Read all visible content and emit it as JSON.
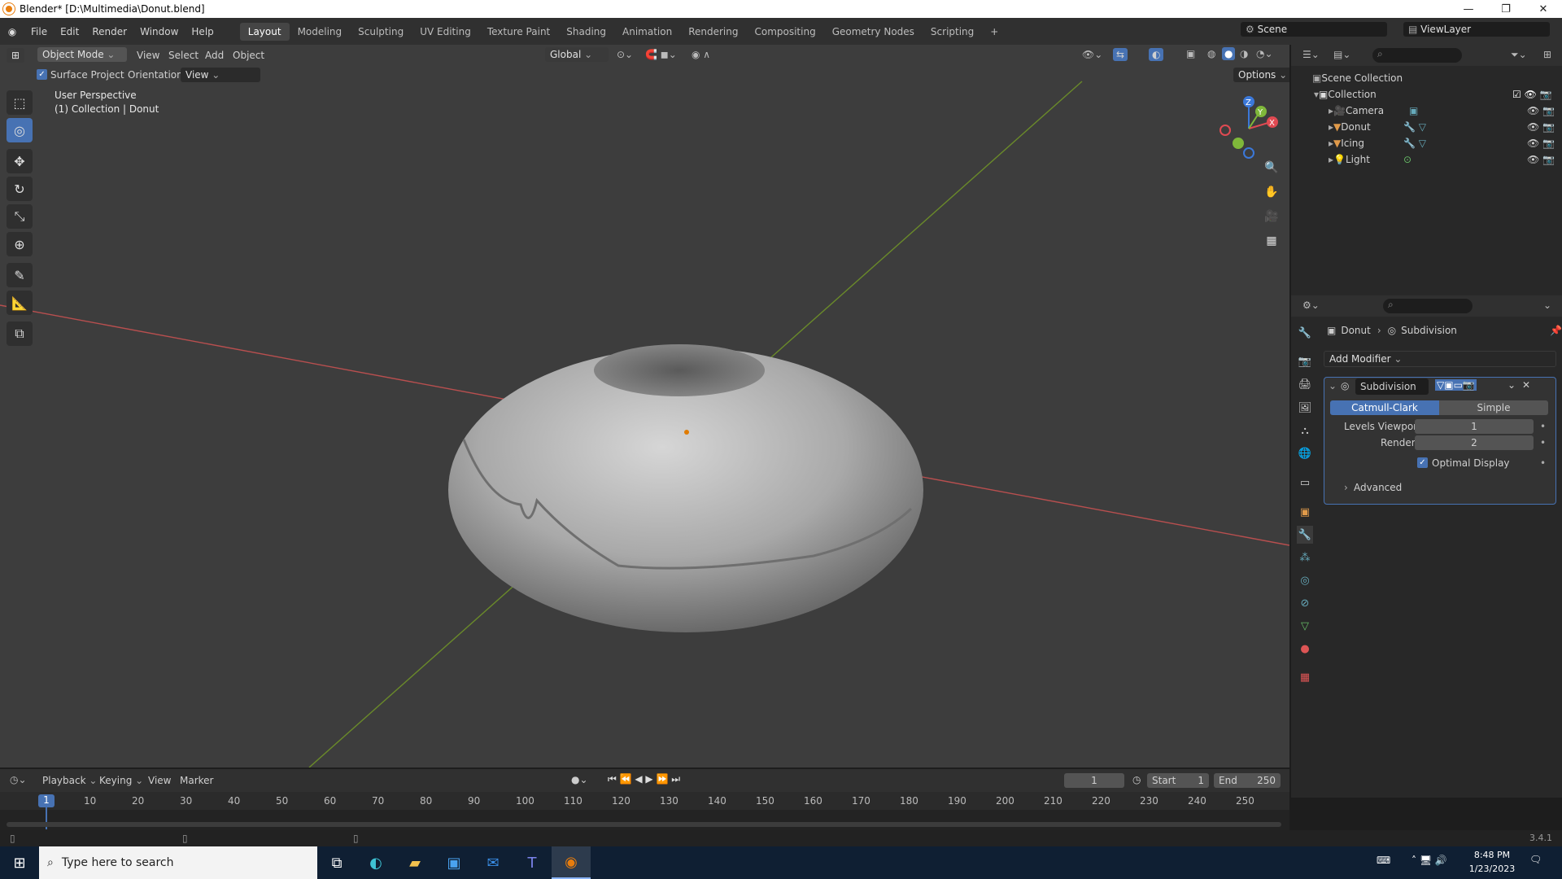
{
  "window": {
    "title": "Blender* [D:\\Multimedia\\Donut.blend]"
  },
  "menu": [
    "File",
    "Edit",
    "Render",
    "Window",
    "Help"
  ],
  "workspaces": [
    "Layout",
    "Modeling",
    "Sculpting",
    "UV Editing",
    "Texture Paint",
    "Shading",
    "Animation",
    "Rendering",
    "Compositing",
    "Geometry Nodes",
    "Scripting"
  ],
  "scene_field": "Scene",
  "viewlayer_field": "ViewLayer",
  "viewport": {
    "mode": "Object Mode",
    "menus": [
      "View",
      "Select",
      "Add",
      "Object"
    ],
    "orientation_global": "Global",
    "surface_project": "Surface Project",
    "orientation_label": "Orientation:",
    "orientation_value": "View",
    "options": "Options",
    "persp": "User Perspective",
    "collection_info": "(1) Collection | Donut",
    "gizmo": {
      "x": "X",
      "y": "Y",
      "z": "Z"
    }
  },
  "outliner": {
    "scene_collection": "Scene Collection",
    "collection": "Collection",
    "items": [
      "Camera",
      "Donut",
      "Icing",
      "Light"
    ]
  },
  "properties": {
    "object": "Donut",
    "modifier_crumb": "Subdivision",
    "add_modifier": "Add Modifier",
    "modifier_name": "Subdivision",
    "catmull": "Catmull-Clark",
    "simple": "Simple",
    "levels_viewport_label": "Levels Viewport",
    "levels_viewport": "1",
    "render_label": "Render",
    "render": "2",
    "optimal_display": "Optimal Display",
    "advanced": "Advanced"
  },
  "timeline": {
    "menus": [
      "Playback",
      "Keying",
      "View",
      "Marker"
    ],
    "frame": "1",
    "start_label": "Start",
    "start": "1",
    "end_label": "End",
    "end": "250",
    "current": "1",
    "ticks": [
      "10",
      "20",
      "30",
      "40",
      "50",
      "60",
      "70",
      "80",
      "90",
      "100",
      "110",
      "120",
      "130",
      "140",
      "150",
      "160",
      "170",
      "180",
      "190",
      "200",
      "210",
      "220",
      "230",
      "240",
      "250"
    ]
  },
  "status": {
    "version": "3.4.1"
  },
  "taskbar": {
    "search": "Type here to search",
    "time": "8:48 PM",
    "date": "1/23/2023"
  }
}
